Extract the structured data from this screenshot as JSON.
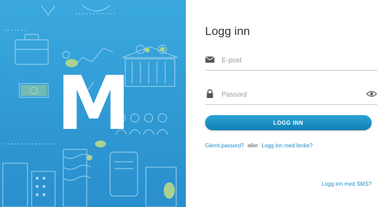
{
  "brand": {
    "logo_letter": "M",
    "hero_color": "#3aa9df"
  },
  "login": {
    "title": "Logg inn",
    "email_placeholder": "E-post",
    "password_placeholder": "Passord",
    "submit_label": "LOGG INN",
    "forgot_password_link": "Glemt passord?",
    "or_text": "eller",
    "login_with_link": "Logg inn med lenke?",
    "sms_link": "Logg inn med SMS?"
  },
  "icons": {
    "email": "envelope-icon",
    "password": "lock-icon",
    "reveal": "eye-icon"
  },
  "colors": {
    "accent": "#1f8fca",
    "button": "#1a8fc4"
  }
}
